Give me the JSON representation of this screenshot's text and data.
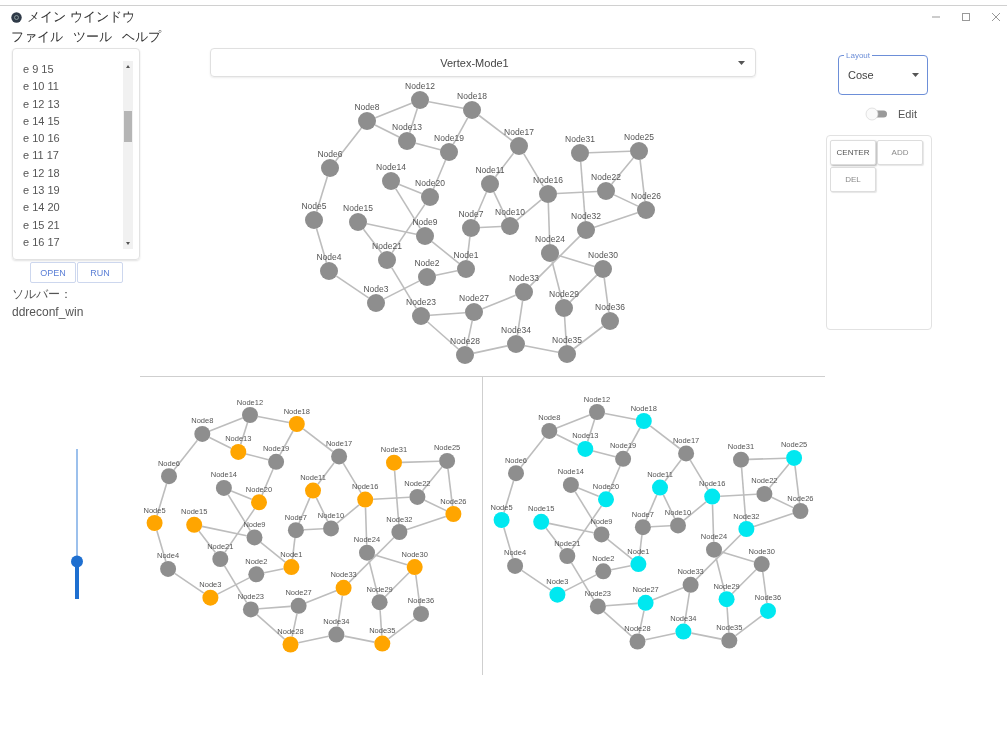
{
  "window": {
    "title": "メイン ウインドウ"
  },
  "menu": [
    "ファイル",
    "ツール",
    "ヘルプ"
  ],
  "edge_list": {
    "items": [
      "e 9 15",
      "e 10 11",
      "e 12 13",
      "e 14 15",
      "e 10 16",
      "e 11 17",
      "e 12 18",
      "e 13 19",
      "e 14 20",
      "e 15 21",
      "e 16 17"
    ]
  },
  "file_buttons": [
    {
      "label": "OPEN"
    },
    {
      "label": "RUN"
    }
  ],
  "solver": {
    "label": "ソルバー：",
    "value": "ddreconf_win"
  },
  "slider": {
    "level": 0.25
  },
  "mode_select": {
    "value": "Vertex-Mode1"
  },
  "graphs": [
    {
      "nodes": [
        {
          "label": "Node12",
          "color": "#8e8e8e"
        },
        {
          "label": "Node8",
          "color": "#8e8e8e"
        },
        {
          "label": "Node18",
          "color": "#8e8e8e"
        },
        {
          "label": "Node13",
          "color": "#8e8e8e"
        },
        {
          "label": "Node19",
          "color": "#8e8e8e"
        },
        {
          "label": "Node17",
          "color": "#8e8e8e"
        },
        {
          "label": "Node6",
          "color": "#8e8e8e"
        },
        {
          "label": "Node31",
          "color": "#8e8e8e"
        },
        {
          "label": "Node25",
          "color": "#8e8e8e"
        },
        {
          "label": "Node14",
          "color": "#8e8e8e"
        },
        {
          "label": "Node20",
          "color": "#8e8e8e"
        },
        {
          "label": "Node11",
          "color": "#8e8e8e"
        },
        {
          "label": "Node16",
          "color": "#8e8e8e"
        },
        {
          "label": "Node22",
          "color": "#8e8e8e"
        },
        {
          "label": "Node26",
          "color": "#8e8e8e"
        },
        {
          "label": "Node5",
          "color": "#8e8e8e"
        },
        {
          "label": "Node15",
          "color": "#8e8e8e"
        },
        {
          "label": "Node9",
          "color": "#8e8e8e"
        },
        {
          "label": "Node7",
          "color": "#8e8e8e"
        },
        {
          "label": "Node10",
          "color": "#8e8e8e"
        },
        {
          "label": "Node32",
          "color": "#8e8e8e"
        },
        {
          "label": "Node24",
          "color": "#8e8e8e"
        },
        {
          "label": "Node21",
          "color": "#8e8e8e"
        },
        {
          "label": "Node1",
          "color": "#8e8e8e"
        },
        {
          "label": "Node30",
          "color": "#8e8e8e"
        },
        {
          "label": "Node2",
          "color": "#8e8e8e"
        },
        {
          "label": "Node4",
          "color": "#8e8e8e"
        },
        {
          "label": "Node33",
          "color": "#8e8e8e"
        },
        {
          "label": "Node3",
          "color": "#8e8e8e"
        },
        {
          "label": "Node23",
          "color": "#8e8e8e"
        },
        {
          "label": "Node27",
          "color": "#8e8e8e"
        },
        {
          "label": "Node29",
          "color": "#8e8e8e"
        },
        {
          "label": "Node36",
          "color": "#8e8e8e"
        },
        {
          "label": "Node34",
          "color": "#8e8e8e"
        },
        {
          "label": "Node28",
          "color": "#8e8e8e"
        },
        {
          "label": "Node35",
          "color": "#8e8e8e"
        }
      ]
    },
    {
      "nodes": [
        {
          "label": "Node12",
          "color": "#8e8e8e"
        },
        {
          "label": "Node8",
          "color": "#8e8e8e"
        },
        {
          "label": "Node18",
          "color": "#ffa500"
        },
        {
          "label": "Node13",
          "color": "#ffa500"
        },
        {
          "label": "Node19",
          "color": "#8e8e8e"
        },
        {
          "label": "Node17",
          "color": "#8e8e8e"
        },
        {
          "label": "Node6",
          "color": "#8e8e8e"
        },
        {
          "label": "Node31",
          "color": "#ffa500"
        },
        {
          "label": "Node25",
          "color": "#8e8e8e"
        },
        {
          "label": "Node14",
          "color": "#8e8e8e"
        },
        {
          "label": "Node20",
          "color": "#ffa500"
        },
        {
          "label": "Node11",
          "color": "#ffa500"
        },
        {
          "label": "Node16",
          "color": "#ffa500"
        },
        {
          "label": "Node22",
          "color": "#8e8e8e"
        },
        {
          "label": "Node26",
          "color": "#ffa500"
        },
        {
          "label": "Node5",
          "color": "#ffa500"
        },
        {
          "label": "Node15",
          "color": "#ffa500"
        },
        {
          "label": "Node9",
          "color": "#8e8e8e"
        },
        {
          "label": "Node7",
          "color": "#8e8e8e"
        },
        {
          "label": "Node10",
          "color": "#8e8e8e"
        },
        {
          "label": "Node32",
          "color": "#8e8e8e"
        },
        {
          "label": "Node24",
          "color": "#8e8e8e"
        },
        {
          "label": "Node21",
          "color": "#8e8e8e"
        },
        {
          "label": "Node1",
          "color": "#ffa500"
        },
        {
          "label": "Node30",
          "color": "#ffa500"
        },
        {
          "label": "Node2",
          "color": "#8e8e8e"
        },
        {
          "label": "Node4",
          "color": "#8e8e8e"
        },
        {
          "label": "Node33",
          "color": "#ffa500"
        },
        {
          "label": "Node3",
          "color": "#ffa500"
        },
        {
          "label": "Node23",
          "color": "#8e8e8e"
        },
        {
          "label": "Node27",
          "color": "#8e8e8e"
        },
        {
          "label": "Node29",
          "color": "#8e8e8e"
        },
        {
          "label": "Node36",
          "color": "#8e8e8e"
        },
        {
          "label": "Node34",
          "color": "#8e8e8e"
        },
        {
          "label": "Node28",
          "color": "#ffa500"
        },
        {
          "label": "Node35",
          "color": "#ffa500"
        }
      ]
    },
    {
      "nodes": [
        {
          "label": "Node12",
          "color": "#8e8e8e"
        },
        {
          "label": "Node8",
          "color": "#8e8e8e"
        },
        {
          "label": "Node18",
          "color": "#00e8f0"
        },
        {
          "label": "Node13",
          "color": "#00e8f0"
        },
        {
          "label": "Node19",
          "color": "#8e8e8e"
        },
        {
          "label": "Node17",
          "color": "#8e8e8e"
        },
        {
          "label": "Node6",
          "color": "#8e8e8e"
        },
        {
          "label": "Node31",
          "color": "#8e8e8e"
        },
        {
          "label": "Node25",
          "color": "#00e8f0"
        },
        {
          "label": "Node14",
          "color": "#8e8e8e"
        },
        {
          "label": "Node20",
          "color": "#00e8f0"
        },
        {
          "label": "Node11",
          "color": "#00e8f0"
        },
        {
          "label": "Node16",
          "color": "#00e8f0"
        },
        {
          "label": "Node22",
          "color": "#8e8e8e"
        },
        {
          "label": "Node26",
          "color": "#8e8e8e"
        },
        {
          "label": "Node5",
          "color": "#00e8f0"
        },
        {
          "label": "Node15",
          "color": "#00e8f0"
        },
        {
          "label": "Node9",
          "color": "#8e8e8e"
        },
        {
          "label": "Node7",
          "color": "#8e8e8e"
        },
        {
          "label": "Node10",
          "color": "#8e8e8e"
        },
        {
          "label": "Node32",
          "color": "#00e8f0"
        },
        {
          "label": "Node24",
          "color": "#8e8e8e"
        },
        {
          "label": "Node21",
          "color": "#8e8e8e"
        },
        {
          "label": "Node1",
          "color": "#00e8f0"
        },
        {
          "label": "Node30",
          "color": "#8e8e8e"
        },
        {
          "label": "Node2",
          "color": "#8e8e8e"
        },
        {
          "label": "Node4",
          "color": "#8e8e8e"
        },
        {
          "label": "Node33",
          "color": "#8e8e8e"
        },
        {
          "label": "Node3",
          "color": "#00e8f0"
        },
        {
          "label": "Node23",
          "color": "#8e8e8e"
        },
        {
          "label": "Node27",
          "color": "#00e8f0"
        },
        {
          "label": "Node29",
          "color": "#00e8f0"
        },
        {
          "label": "Node36",
          "color": "#00e8f0"
        },
        {
          "label": "Node34",
          "color": "#00e8f0"
        },
        {
          "label": "Node28",
          "color": "#8e8e8e"
        },
        {
          "label": "Node35",
          "color": "#8e8e8e"
        }
      ]
    }
  ],
  "layout_select": {
    "label": "Layout",
    "value": "Cose"
  },
  "edit_toggle": {
    "label": "Edit",
    "on": false
  },
  "tool_buttons": [
    {
      "label": "CENTER",
      "disabled": false
    },
    {
      "label": "ADD",
      "disabled": true
    },
    {
      "label": "DEL",
      "disabled": true
    }
  ]
}
